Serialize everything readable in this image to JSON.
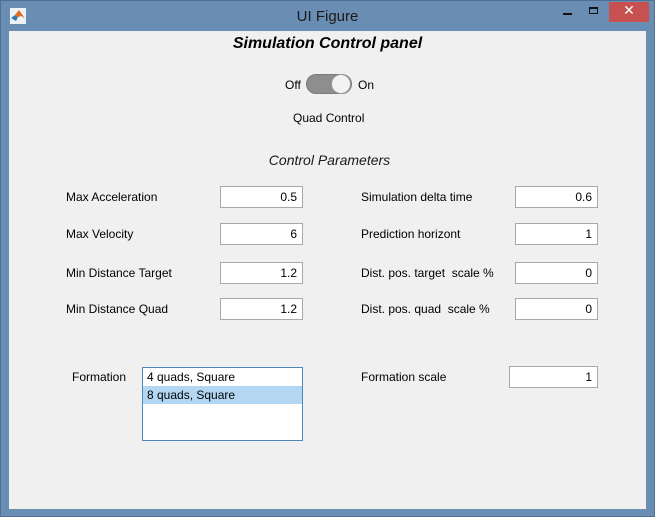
{
  "window": {
    "title": "UI Figure",
    "icon": "matlab-logo-icon",
    "controls": {
      "minimize": "minimize-icon",
      "maximize": "maximize-icon",
      "close": "✕"
    }
  },
  "panel": {
    "title": "Simulation Control panel",
    "switch": {
      "off_label": "Off",
      "on_label": "On",
      "state": "On",
      "caption": "Quad Control"
    },
    "section_title": "Control Parameters",
    "left_params": [
      {
        "label": "Max Acceleration",
        "value": "0.5"
      },
      {
        "label": "Max Velocity",
        "value": "6"
      },
      {
        "label": "Min Distance Target",
        "value": "1.2"
      },
      {
        "label": "Min Distance Quad",
        "value": "1.2"
      }
    ],
    "right_params": [
      {
        "label": "Simulation delta time",
        "value": "0.6"
      },
      {
        "label": "Prediction horizont",
        "value": "1"
      },
      {
        "label": "Dist. pos. target  scale %",
        "value": "0"
      },
      {
        "label": "Dist. pos. quad  scale %",
        "value": "0"
      }
    ],
    "formation": {
      "label": "Formation",
      "options": [
        "4 quads, Square",
        "8 quads, Square"
      ],
      "selected": "8 quads, Square"
    },
    "formation_scale": {
      "label": "Formation scale",
      "value": "1"
    }
  },
  "colors": {
    "titlebar": "#6a8db3",
    "close_button": "#c75050",
    "panel_background": "#f0f0f0",
    "list_selection": "#b3d7f3",
    "switch_track": "#8e8e8e"
  }
}
